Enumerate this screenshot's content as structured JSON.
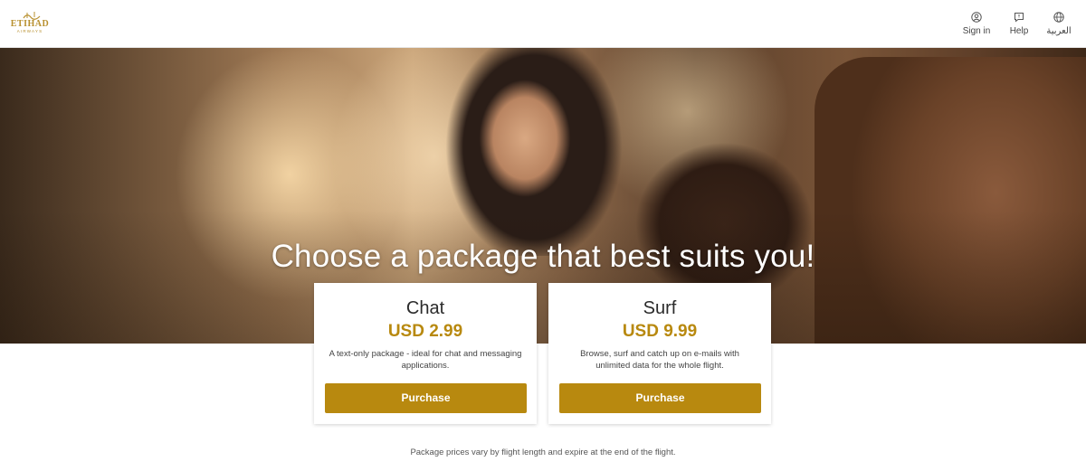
{
  "brand": {
    "logo_text": "ETIHAD",
    "logo_subtext": "AIRWAYS",
    "accent_color": "#b8890f"
  },
  "nav": {
    "signin": {
      "label": "Sign in",
      "icon": "user-circle-icon"
    },
    "help": {
      "label": "Help",
      "icon": "chat-flag-icon"
    },
    "language": {
      "label": "العربية",
      "icon": "globe-icon"
    }
  },
  "hero": {
    "title": "Choose a package that best suits you!"
  },
  "packages": [
    {
      "name": "Chat",
      "price": "USD 2.99",
      "description": "A text-only package - ideal for chat and messaging applications.",
      "button": "Purchase"
    },
    {
      "name": "Surf",
      "price": "USD 9.99",
      "description": "Browse, surf and catch up on e-mails with unlimited data for the whole flight.",
      "button": "Purchase"
    }
  ],
  "footnote": "Package prices vary by flight length and expire at the end of the flight."
}
